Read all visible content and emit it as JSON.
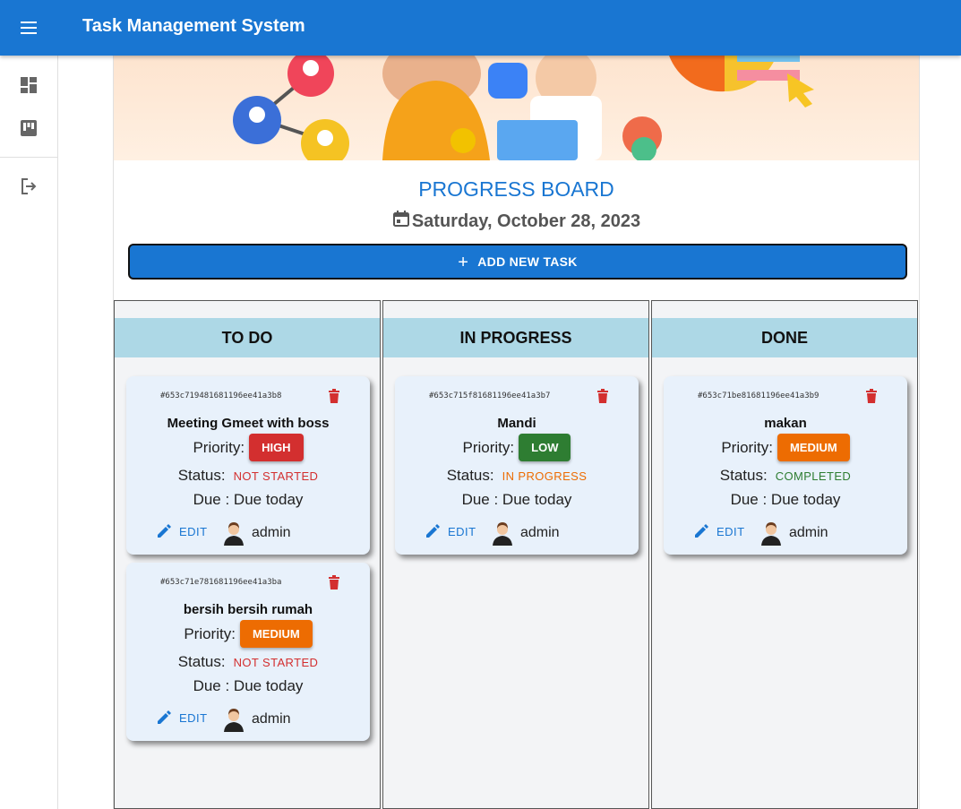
{
  "app": {
    "title": "Task Management System"
  },
  "colors": {
    "primary": "#1976d2",
    "column_header": "#add8e6",
    "card_bg": "#e8f1fb",
    "high": "#d32f2f",
    "low": "#2e7d32",
    "medium": "#ed6c02",
    "not_started": "#d32f2f",
    "in_progress": "#ed6c02",
    "completed": "#2e7d32"
  },
  "sidebar": {
    "items": [
      {
        "icon": "dashboard-icon"
      },
      {
        "icon": "kanban-board-icon"
      },
      {
        "icon": "logout-icon"
      }
    ]
  },
  "board": {
    "title": "PROGRESS BOARD",
    "date": "Saturday, October 28, 2023",
    "add_button_label": "ADD NEW TASK"
  },
  "labels": {
    "priority": "Priority:",
    "status": "Status:",
    "due_prefix": "Due : ",
    "edit": "EDIT"
  },
  "columns": [
    {
      "title": "TO DO",
      "cards": [
        {
          "id": "#653c719481681196ee41a3b8",
          "title": "Meeting Gmeet with boss",
          "priority": "HIGH",
          "status": "NOT STARTED",
          "due": "Due today",
          "user": "admin"
        },
        {
          "id": "#653c71e781681196ee41a3ba",
          "title": "bersih bersih rumah",
          "priority": "MEDIUM",
          "status": "NOT STARTED",
          "due": "Due today",
          "user": "admin"
        }
      ]
    },
    {
      "title": "IN PROGRESS",
      "cards": [
        {
          "id": "#653c715f81681196ee41a3b7",
          "title": "Mandi",
          "priority": "LOW",
          "status": "IN PROGRESS",
          "due": "Due today",
          "user": "admin"
        }
      ]
    },
    {
      "title": "DONE",
      "cards": [
        {
          "id": "#653c71be81681196ee41a3b9",
          "title": "makan",
          "priority": "MEDIUM",
          "status": "COMPLETED",
          "due": "Due today",
          "user": "admin"
        }
      ]
    }
  ]
}
